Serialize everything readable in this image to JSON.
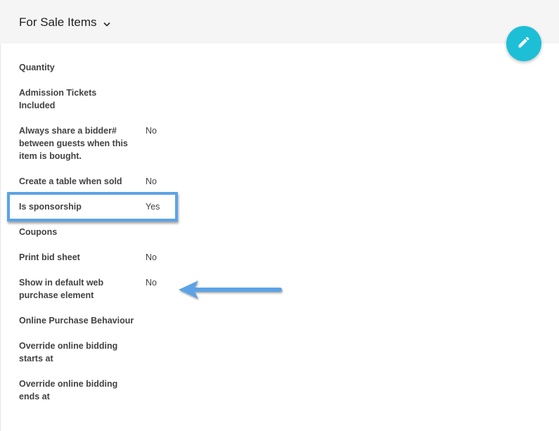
{
  "header": {
    "title": "For Sale Items",
    "dropdown_icon": "chevron-down-icon",
    "edit_icon": "pencil-icon",
    "accent_color": "#1cbfd6"
  },
  "fields": [
    {
      "label": "Quantity",
      "value": ""
    },
    {
      "label": "Admission Tickets Included",
      "value": ""
    },
    {
      "label": "Always share a bidder# between guests when this item is bought.",
      "value": "No"
    },
    {
      "label": "Create a table when sold",
      "value": "No"
    },
    {
      "label": "Is sponsorship",
      "value": "Yes"
    },
    {
      "label": "Coupons",
      "value": ""
    },
    {
      "label": "Print bid sheet",
      "value": "No"
    },
    {
      "label": "Show in default web purchase element",
      "value": "No"
    },
    {
      "label": "Online Purchase Behaviour",
      "value": ""
    },
    {
      "label": "Override online bidding starts at",
      "value": ""
    },
    {
      "label": "Override online bidding ends at",
      "value": ""
    }
  ],
  "annotation": {
    "highlight_color": "#5ca3e6",
    "arrow_icon": "left-arrow-icon"
  }
}
